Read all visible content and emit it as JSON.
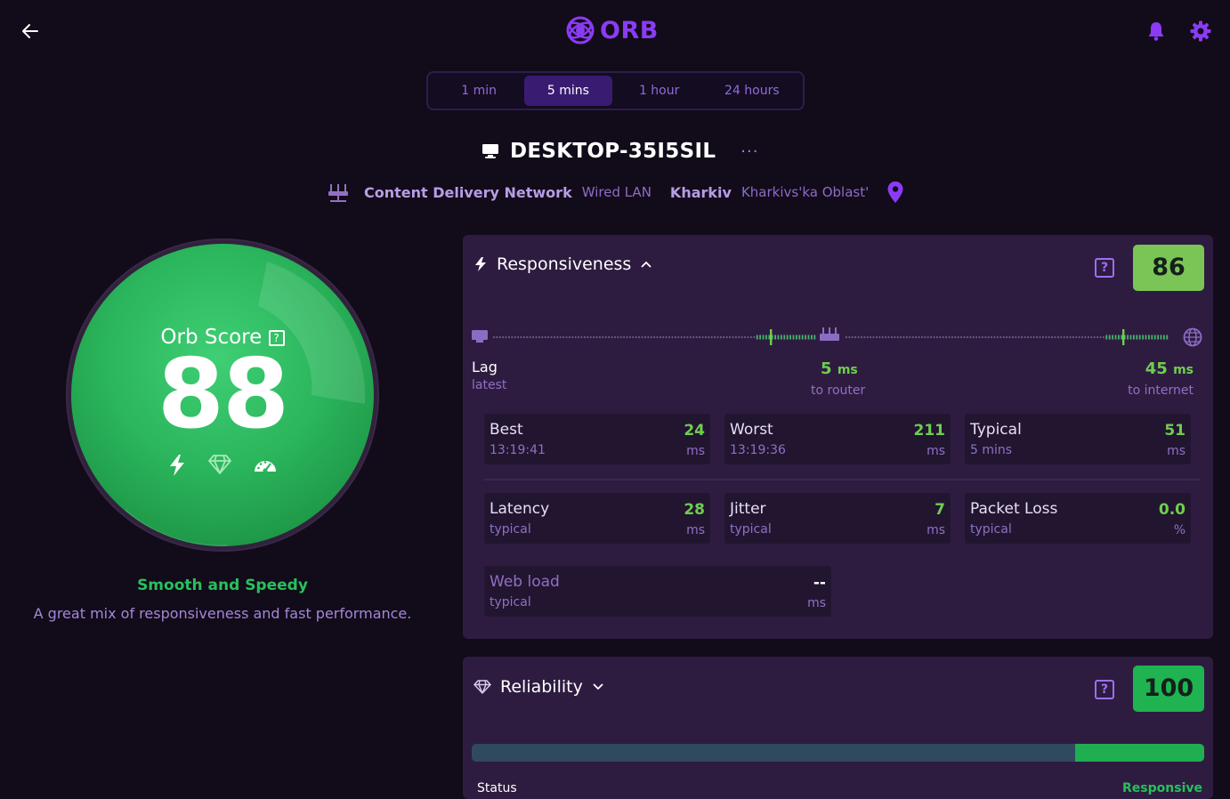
{
  "header": {
    "brand": "ORB"
  },
  "tabs": [
    {
      "label": "1 min",
      "active": false
    },
    {
      "label": "5 mins",
      "active": true
    },
    {
      "label": "1 hour",
      "active": false
    },
    {
      "label": "24 hours",
      "active": false
    }
  ],
  "device": {
    "name": "DESKTOP-35I5SIL",
    "more": "···",
    "network_name": "Content Delivery Network",
    "network_type": "Wired LAN",
    "city": "Kharkiv",
    "region": "Kharkivs'ka Oblast'"
  },
  "orb": {
    "title": "Orb Score",
    "score": "88",
    "verdict": "Smooth and Speedy",
    "description": "A great mix of responsiveness and fast performance."
  },
  "responsiveness": {
    "title": "Responsiveness",
    "score": "86",
    "score_color": "#7ac555",
    "help": "?",
    "lag": {
      "label": "Lag",
      "sub": "latest",
      "router_value": "5",
      "router_unit": "ms",
      "router_sub": "to router",
      "internet_value": "45",
      "internet_unit": "ms",
      "internet_sub": "to internet"
    },
    "stats": [
      {
        "label": "Best",
        "sub": "13:19:41",
        "value": "24",
        "unit": "ms"
      },
      {
        "label": "Worst",
        "sub": "13:19:36",
        "value": "211",
        "unit": "ms"
      },
      {
        "label": "Typical",
        "sub": "5 mins",
        "value": "51",
        "unit": "ms"
      },
      {
        "label": "Latency",
        "sub": "typical",
        "value": "28",
        "unit": "ms"
      },
      {
        "label": "Jitter",
        "sub": "typical",
        "value": "7",
        "unit": "ms"
      },
      {
        "label": "Packet Loss",
        "sub": "typical",
        "value": "0.0",
        "unit": "%"
      },
      {
        "label": "Web load",
        "sub": "typical",
        "value": "--",
        "unit": "ms"
      }
    ]
  },
  "reliability": {
    "title": "Reliability",
    "score": "100",
    "score_color": "#1fb352",
    "help": "?",
    "uptime_fraction": 0.176,
    "footer_left": "Status",
    "footer_right": "Responsive"
  },
  "colors": {
    "background": "#120b19",
    "card": "#2e1c40",
    "accent_purple": "#8b3bf5",
    "good_green": "#6ecf4e"
  }
}
